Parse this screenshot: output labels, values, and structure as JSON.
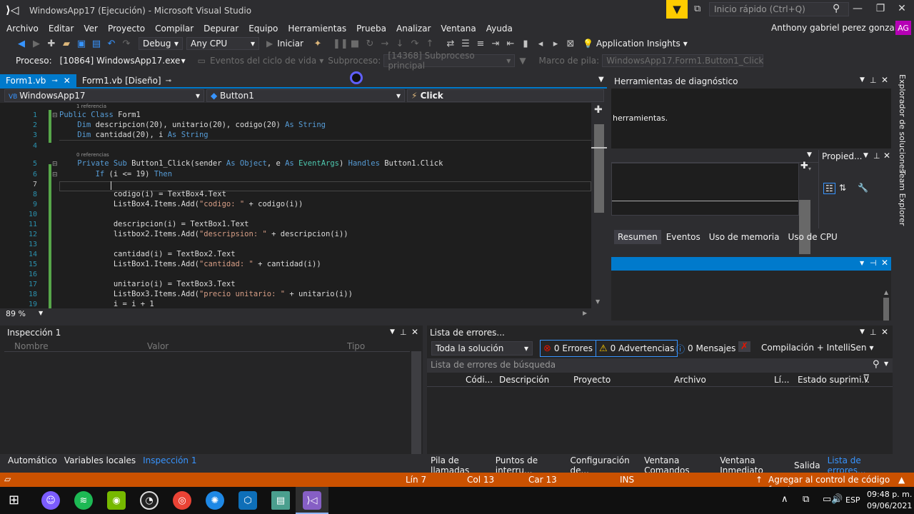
{
  "window": {
    "title": "WindowsApp17 (Ejecución) - Microsoft Visual Studio"
  },
  "quick_launch": {
    "placeholder": "Inicio rápido (Ctrl+Q)"
  },
  "menu": [
    "Archivo",
    "Editar",
    "Ver",
    "Proyecto",
    "Compilar",
    "Depurar",
    "Equipo",
    "Herramientas",
    "Prueba",
    "Analizar",
    "Ventana",
    "Ayuda"
  ],
  "user": {
    "name": "Anthony gabriel perez gonzalez",
    "initials": "AG"
  },
  "toolbar": {
    "config": "Debug",
    "platform": "Any CPU",
    "start": "Iniciar",
    "insights": "Application Insights"
  },
  "debug_bar": {
    "process_label": "Proceso:",
    "process_value": "[10864] WindowsApp17.exe",
    "lifecycle": "Eventos del ciclo de vida",
    "thread_label": "Subproceso:",
    "thread_value": "[14368] Subproceso principal",
    "stack_label": "Marco de pila:",
    "stack_value": "WindowsApp17.Form1.Button1_Click"
  },
  "tabs": [
    {
      "label": "Form1.vb"
    },
    {
      "label": "Form1.vb [Diseño]"
    }
  ],
  "nav": {
    "project": "WindowsApp17",
    "object": "Button1",
    "member": "Click"
  },
  "code": {
    "refs": [
      "1 referencia",
      "0 referencias"
    ],
    "numbers": [
      "1",
      "2",
      "3",
      "4",
      "5",
      "6",
      "7",
      "8",
      "9",
      "10",
      "11",
      "12",
      "13",
      "14",
      "15",
      "16",
      "17",
      "18",
      "19"
    ],
    "l1a": "Public Class",
    "l1b": " Form1",
    "l2a": "    Dim",
    "l2b": " descripcion(20), unitario(20), codigo(20) ",
    "l2c": "As String",
    "l3a": "    Dim",
    "l3b": " cantidad(20), i ",
    "l3c": "As String",
    "l5a": "    Private Sub",
    "l5b": " Button1_Click(sender ",
    "l5c": "As Object",
    "l5d": ", e ",
    "l5e": "As",
    "l5f": " EventArgs",
    "l5g": ") ",
    "l5h": "Handles",
    "l5i": " Button1.Click",
    "l6a": "        If",
    "l6b": " (i <= 19) ",
    "l6c": "Then",
    "l8": "            codigo(i) = TextBox4.Text",
    "l9a": "            ListBox4.Items.Add(",
    "l9b": "\"codigo: \"",
    "l9c": " + codigo(i))",
    "l11": "            descripcion(i) = TextBox1.Text",
    "l12a": "            listbox2.Items.Add(",
    "l12b": "\"descripsion: \"",
    "l12c": " + descripcion(i))",
    "l14": "            cantidad(i) = TextBox2.Text",
    "l15a": "            ListBox1.Items.Add(",
    "l15b": "\"cantidad: \"",
    "l15c": " + cantidad(i))",
    "l17": "            unitario(i) = TextBox3.Text",
    "l18a": "            ListBox3.Items.Add(",
    "l18b": "\"precio unitario: \"",
    "l18c": " + unitario(i))",
    "l19": "            i = i + 1"
  },
  "zoom": "89 %",
  "diagnostics": {
    "title": "Herramientas de diagnóstico",
    "text": "herramientas.",
    "props": "Propied...",
    "tabs": [
      "Resumen",
      "Eventos",
      "Uso de memoria",
      "Uso de CPU"
    ]
  },
  "side": {
    "solution": "Explorador de soluciones",
    "team": "Team Explorer"
  },
  "watch": {
    "title": "Inspección 1",
    "cols": [
      "Nombre",
      "Valor",
      "Tipo"
    ]
  },
  "errors": {
    "title": "Lista de errores...",
    "scope": "Toda la solución",
    "errors": "0 Errores",
    "warnings": "0 Advertencias",
    "messages": "0 Mensajes",
    "build": "Compilación + IntelliSen",
    "search": "Lista de errores de búsqueda",
    "cols": [
      "Códi...",
      "Descripción",
      "Proyecto",
      "Archivo",
      "Lí...",
      "Estado suprimi..."
    ]
  },
  "bottom_left_tabs": [
    "Automático",
    "Variables locales",
    "Inspección 1"
  ],
  "bottom_right_tabs": [
    "Pila de llamadas",
    "Puntos de interru...",
    "Configuración de...",
    "Ventana Comandos",
    "Ventana Inmediato",
    "Salida",
    "Lista de errores..."
  ],
  "status": {
    "line": "Lín 7",
    "col": "Col 13",
    "car": "Car 13",
    "ins": "INS",
    "scm": "Agregar al control de código fuente"
  },
  "tray": {
    "lang": "ESP",
    "time": "09:48 p. m.",
    "date": "09/06/2021"
  },
  "colors": {
    "accent": "#007acc",
    "status": "#ca5100",
    "editor_bg": "#1e1e1e"
  }
}
